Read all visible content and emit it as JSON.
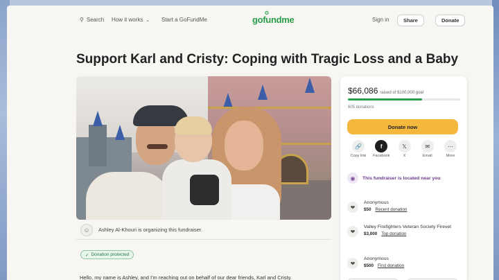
{
  "nav": {
    "search": "Search",
    "how_it_works": "How it works",
    "start": "Start a GoFundMe",
    "logo": "gofundme",
    "signin": "Sign in",
    "share": "Share",
    "donate": "Donate"
  },
  "title": "Support Karl and Cristy: Coping with Tragic Loss and a Baby",
  "organizer": "Ashley Al-Khouri is organizing this fundraiser.",
  "protected": "Donation protected",
  "story_start": "Hello, my name is Ashley, and I'm reaching out on behalf of our dear friends, Karl and Cristy.",
  "sidebar": {
    "amount": "$66,086",
    "goal": "raised of $100,000 goal",
    "progress_fraction": 0.66,
    "count": "605 donations",
    "donate_now": "Donate now",
    "share": [
      {
        "icon": "link-icon",
        "label": "Copy link"
      },
      {
        "icon": "facebook-icon",
        "label": "Facebook"
      },
      {
        "icon": "x-icon",
        "label": "X"
      },
      {
        "icon": "email-icon",
        "label": "Email"
      },
      {
        "icon": "more-icon",
        "label": "More"
      }
    ],
    "nearby": "This fundraiser is located near you",
    "donations": [
      {
        "name": "Anonymous",
        "amount": "$50",
        "tag": "Recent donation"
      },
      {
        "name": "Valley Firefighters Veteran Society Firevet",
        "amount": "$3,000",
        "tag": "Top donation"
      },
      {
        "name": "Anonymous",
        "amount": "$500",
        "tag": "First donation"
      }
    ]
  },
  "colors": {
    "brand": "#2a9d4a",
    "donate_button": "#f4b83e",
    "nearby_text": "#6a3a86"
  }
}
